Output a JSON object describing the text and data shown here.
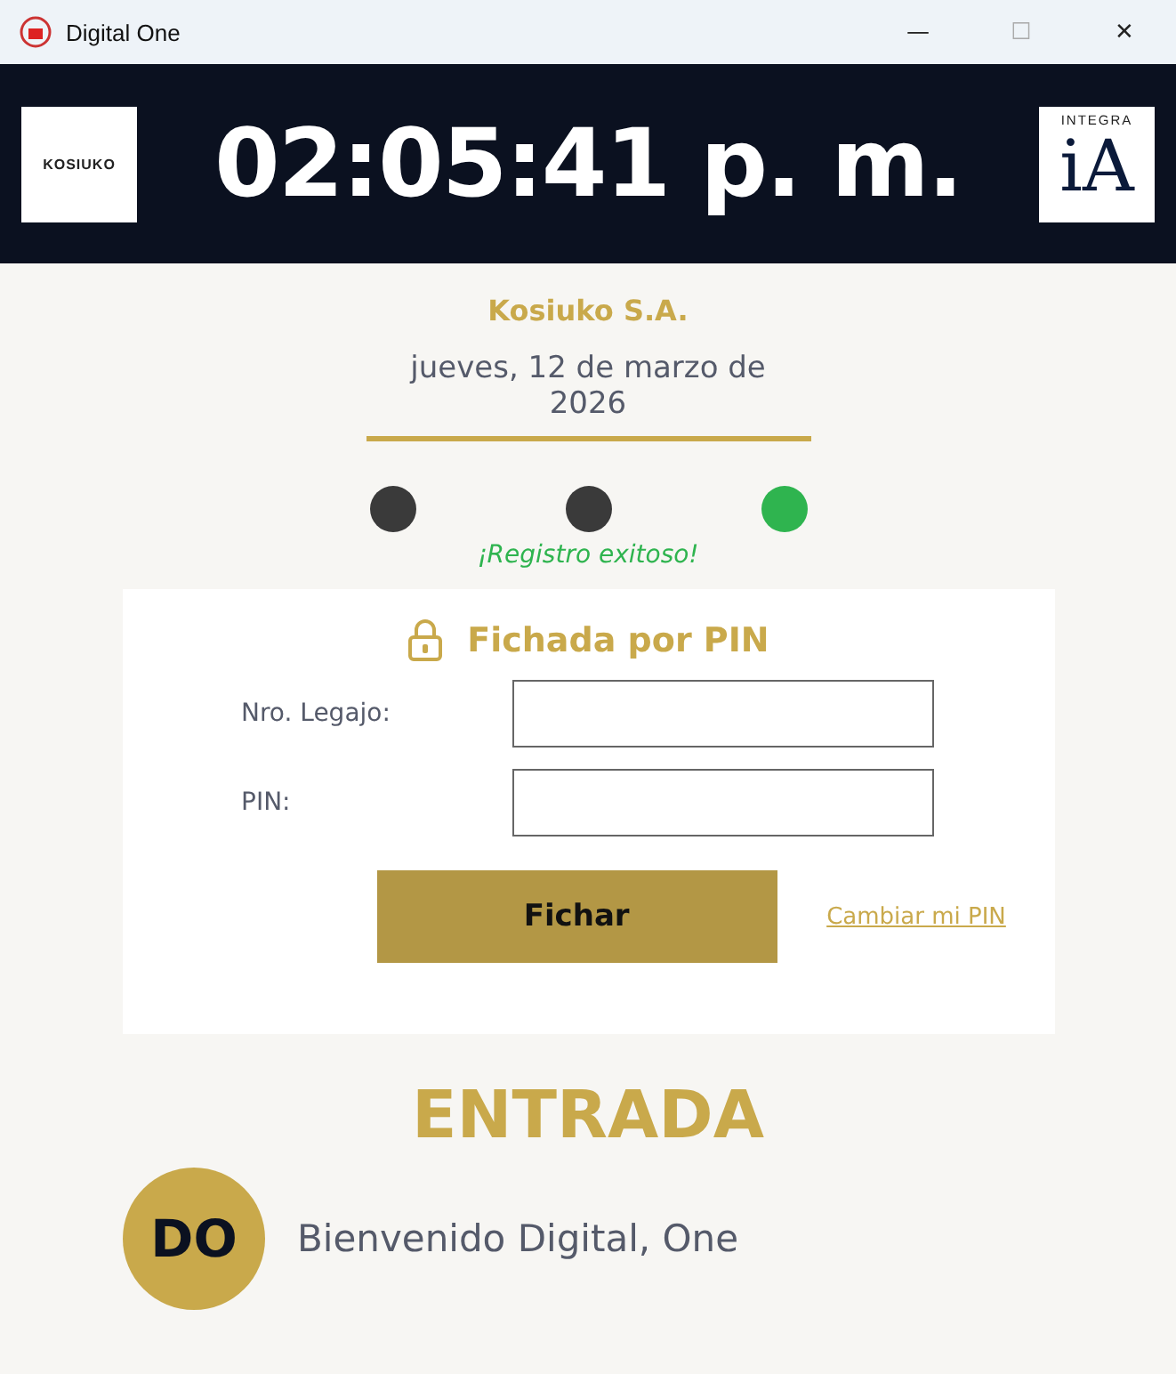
{
  "window": {
    "title": "Digital One",
    "controls": [
      "—",
      "☐",
      "✕"
    ]
  },
  "header": {
    "left_logo": "KOSIUKO",
    "clock": "02:05:41 p. m.",
    "right_logo": {
      "top": "INTEGRA",
      "mark": "iA"
    }
  },
  "company": "Kosiuko S.A.",
  "date": "jueves, 12 de marzo de 2026",
  "status_dots": [
    {
      "color": "#3a3a3a"
    },
    {
      "color": "#3a3a3a"
    },
    {
      "color": "#2fb44f"
    }
  ],
  "status_message": "¡Registro exitoso!",
  "pin_form": {
    "title": "Fichada por PIN",
    "fields": [
      {
        "label": "Nro. Legajo:"
      },
      {
        "label": "PIN:"
      }
    ],
    "submit": "Fichar",
    "link": "Cambiar mi PIN"
  },
  "result": {
    "type": "ENTRADA",
    "initials": "DO",
    "welcome": "Bienvenido Digital, One"
  }
}
